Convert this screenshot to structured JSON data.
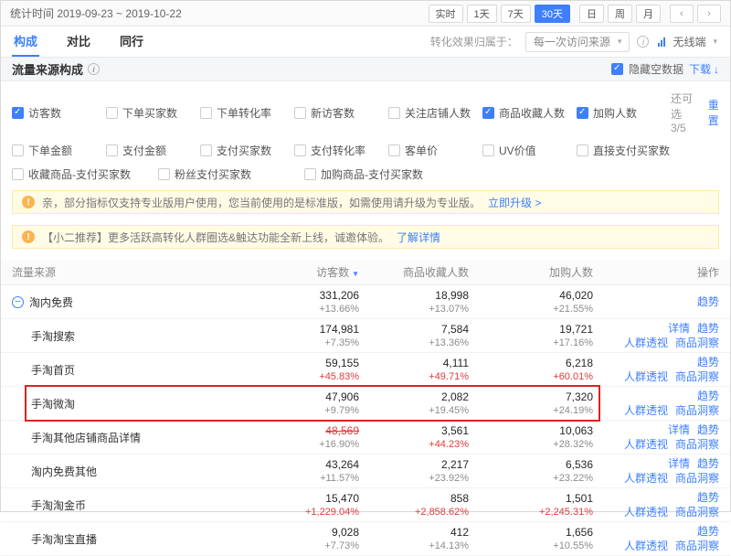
{
  "topbar": {
    "stat_time": "统计时间 2019-09-23 ~ 2019-10-22",
    "range_buttons": [
      {
        "label": "实时",
        "active": false
      },
      {
        "label": "1天",
        "active": false
      },
      {
        "label": "7天",
        "active": false
      },
      {
        "label": "30天",
        "active": true
      }
    ],
    "period_buttons": [
      {
        "label": "日",
        "active": false
      },
      {
        "label": "周",
        "active": false
      },
      {
        "label": "月",
        "active": false
      }
    ]
  },
  "tabs": [
    {
      "label": "构成",
      "active": true
    },
    {
      "label": "对比",
      "active": false
    },
    {
      "label": "同行",
      "active": false
    }
  ],
  "filters": {
    "conversion_label": "转化效果归属于：",
    "source_value": "每一次访问来源",
    "terminal_value": "无线端"
  },
  "section": {
    "title": "流量来源构成",
    "hide_empty_label": "隐藏空数据",
    "hide_empty_checked": true,
    "download_label": "下载"
  },
  "metrics": {
    "row1": [
      {
        "label": "访客数",
        "checked": true
      },
      {
        "label": "下单买家数",
        "checked": false
      },
      {
        "label": "下单转化率",
        "checked": false
      },
      {
        "label": "新访客数",
        "checked": false
      },
      {
        "label": "关注店铺人数",
        "checked": false
      },
      {
        "label": "商品收藏人数",
        "checked": true
      },
      {
        "label": "加购人数",
        "checked": true
      }
    ],
    "row2": [
      {
        "label": "下单金额",
        "checked": false
      },
      {
        "label": "支付金额",
        "checked": false
      },
      {
        "label": "支付买家数",
        "checked": false
      },
      {
        "label": "支付转化率",
        "checked": false
      },
      {
        "label": "客单价",
        "checked": false
      },
      {
        "label": "UV价值",
        "checked": false
      },
      {
        "label": "直接支付买家数",
        "checked": false
      }
    ],
    "row3": [
      {
        "label": "收藏商品-支付买家数",
        "checked": false
      },
      {
        "label": "粉丝支付买家数",
        "checked": false
      },
      {
        "label": "加购商品-支付买家数",
        "checked": false
      }
    ],
    "remaining": "还可选 3/5",
    "reset": "重置"
  },
  "notices": [
    {
      "text": "亲，部分指标仅支持专业版用户使用，您当前使用的是标准版，如需使用请升级为专业版。",
      "link": "立即升级 >"
    },
    {
      "text": "【小二推荐】更多活跃高转化人群圈选&触达功能全新上线，诚邀体验。",
      "link": "了解详情"
    }
  ],
  "table": {
    "headers": {
      "source": "流量来源",
      "visitors": "访客数",
      "collect": "商品收藏人数",
      "cart": "加购人数",
      "actions": "操作"
    },
    "rows": [
      {
        "name": "淘内免费",
        "expand": true,
        "child": false,
        "highlight": false,
        "visitors": "331,206",
        "visitors_chg": "+13.66%",
        "visitors_value_red": false,
        "visitors_struck": false,
        "visitors_chg_red": false,
        "collect": "18,998",
        "collect_chg": "+13.07%",
        "collect_chg_red": false,
        "cart": "46,020",
        "cart_chg": "+21.55%",
        "cart_chg_red": false,
        "act1": [
          "趋势"
        ],
        "act2": []
      },
      {
        "name": "手淘搜索",
        "expand": false,
        "child": true,
        "highlight": false,
        "visitors": "174,981",
        "visitors_chg": "+7.35%",
        "visitors_value_red": false,
        "visitors_struck": false,
        "visitors_chg_red": false,
        "collect": "7,584",
        "collect_chg": "+13.36%",
        "collect_chg_red": false,
        "cart": "19,721",
        "cart_chg": "+17.16%",
        "cart_chg_red": false,
        "act1": [
          "详情",
          "趋势"
        ],
        "act2": [
          "人群透视",
          "商品洞察"
        ]
      },
      {
        "name": "手淘首页",
        "expand": false,
        "child": true,
        "highlight": false,
        "visitors": "59,155",
        "visitors_chg": "+45.83%",
        "visitors_value_red": false,
        "visitors_struck": false,
        "visitors_chg_red": true,
        "collect": "4,111",
        "collect_chg": "+49.71%",
        "collect_chg_red": true,
        "cart": "6,218",
        "cart_chg": "+60.01%",
        "cart_chg_red": true,
        "act1": [
          "趋势"
        ],
        "act2": [
          "人群透视",
          "商品洞察"
        ]
      },
      {
        "name": "手淘微淘",
        "expand": false,
        "child": true,
        "highlight": true,
        "visitors": "47,906",
        "visitors_chg": "+9.79%",
        "visitors_value_red": false,
        "visitors_struck": false,
        "visitors_chg_red": false,
        "collect": "2,082",
        "collect_chg": "+19.45%",
        "collect_chg_red": false,
        "cart": "7,320",
        "cart_chg": "+24.19%",
        "cart_chg_red": false,
        "act1": [
          "趋势"
        ],
        "act2": [
          "人群透视",
          "商品洞察"
        ]
      },
      {
        "name": "手淘其他店铺商品详情",
        "expand": false,
        "child": true,
        "highlight": false,
        "visitors": "48,569",
        "visitors_chg": "+16.90%",
        "visitors_value_red": true,
        "visitors_struck": true,
        "visitors_chg_red": false,
        "collect": "3,561",
        "collect_chg": "+44.23%",
        "collect_chg_red": true,
        "cart": "10,063",
        "cart_chg": "+28.32%",
        "cart_chg_red": false,
        "act1": [
          "详情",
          "趋势"
        ],
        "act2": [
          "人群透视",
          "商品洞察"
        ]
      },
      {
        "name": "淘内免费其他",
        "expand": false,
        "child": true,
        "highlight": false,
        "visitors": "43,264",
        "visitors_chg": "+11.57%",
        "visitors_value_red": false,
        "visitors_struck": false,
        "visitors_chg_red": false,
        "collect": "2,217",
        "collect_chg": "+23.92%",
        "collect_chg_red": false,
        "cart": "6,536",
        "cart_chg": "+23.22%",
        "cart_chg_red": false,
        "act1": [
          "详情",
          "趋势"
        ],
        "act2": [
          "人群透视",
          "商品洞察"
        ]
      },
      {
        "name": "手淘淘金币",
        "expand": false,
        "child": true,
        "highlight": false,
        "visitors": "15,470",
        "visitors_chg": "+1,229.04%",
        "visitors_value_red": false,
        "visitors_struck": false,
        "visitors_chg_red": true,
        "collect": "858",
        "collect_chg": "+2,858.62%",
        "collect_chg_red": true,
        "cart": "1,501",
        "cart_chg": "+2,245.31%",
        "cart_chg_red": true,
        "act1": [
          "趋势"
        ],
        "act2": [
          "人群透视",
          "商品洞察"
        ]
      },
      {
        "name": "手淘淘宝直播",
        "expand": false,
        "child": true,
        "highlight": false,
        "visitors": "9,028",
        "visitors_chg": "+7.73%",
        "visitors_value_red": false,
        "visitors_struck": false,
        "visitors_chg_red": false,
        "collect": "412",
        "collect_chg": "+14.13%",
        "collect_chg_red": false,
        "cart": "1,656",
        "cart_chg": "+10.55%",
        "cart_chg_red": false,
        "act1": [
          "趋势"
        ],
        "act2": [
          "人群透视",
          "商品洞察"
        ]
      }
    ]
  },
  "icons": {
    "caret": "▾",
    "info": "i",
    "download": "↓",
    "sort": "▼",
    "minus": "−",
    "prev": "‹",
    "next": "›",
    "horn": "!"
  }
}
